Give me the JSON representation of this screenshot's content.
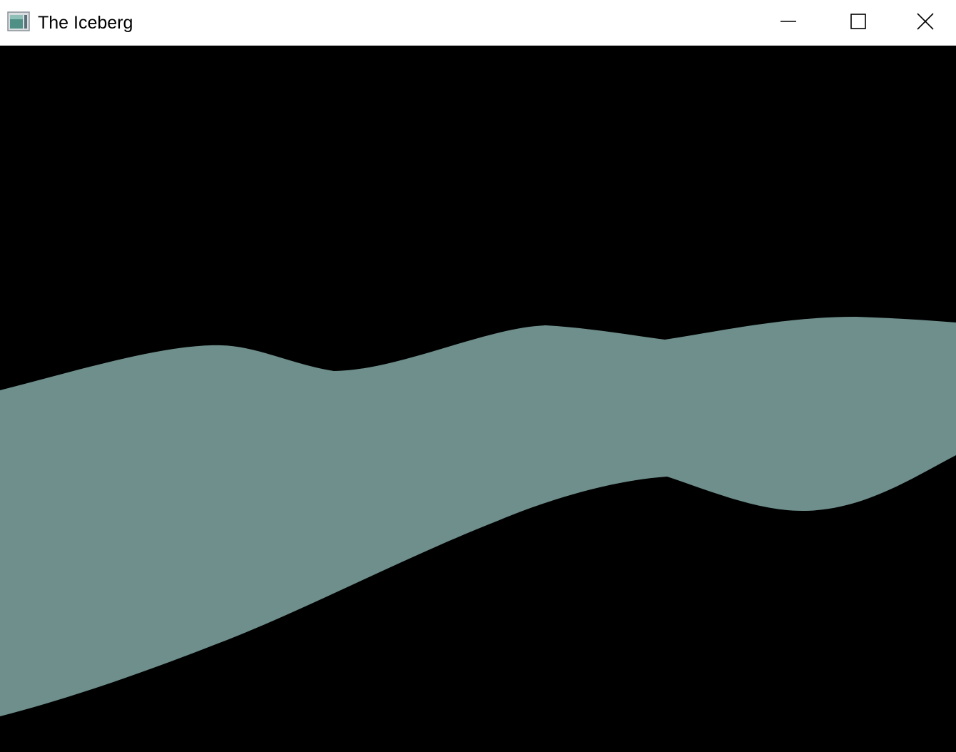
{
  "window": {
    "title": "The Iceberg",
    "app_icon": "app-window-icon",
    "controls": {
      "minimize_icon": "minimize-icon",
      "maximize_icon": "maximize-icon",
      "close_icon": "close-icon"
    }
  },
  "scene": {
    "background_color": "#000000",
    "iceberg_color": "#6e8f8c"
  }
}
